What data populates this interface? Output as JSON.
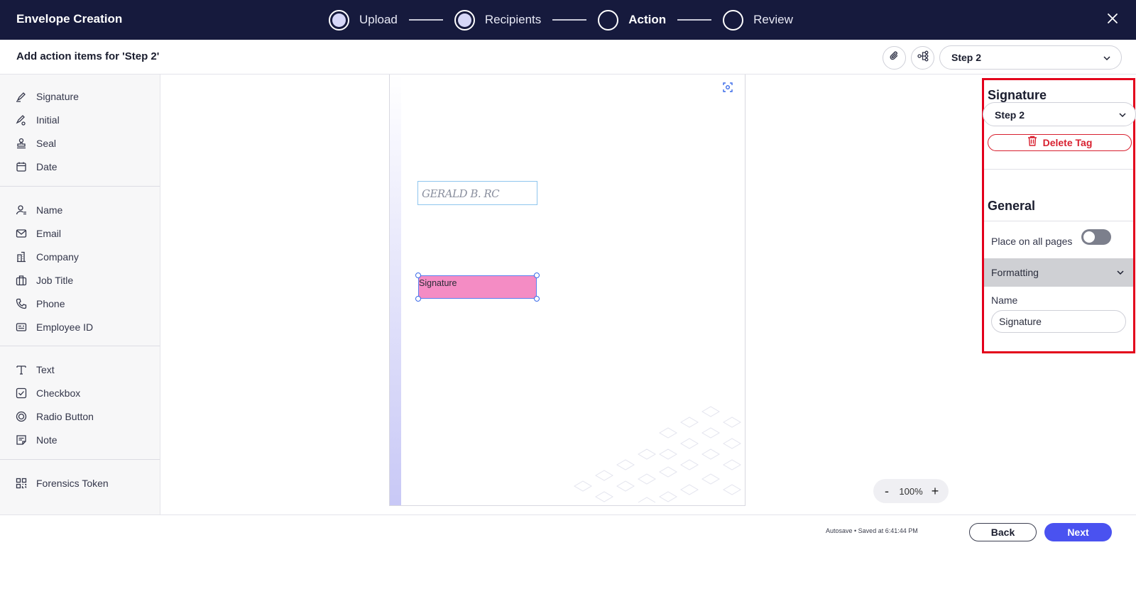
{
  "app": {
    "title": "Envelope Creation",
    "close_icon": "close-icon"
  },
  "stepper": {
    "steps": [
      {
        "label": "Upload",
        "state": "done"
      },
      {
        "label": "Recipients",
        "state": "done"
      },
      {
        "label": "Action",
        "state": "current"
      },
      {
        "label": "Review",
        "state": "todo"
      }
    ]
  },
  "subheader": {
    "title": "Add action items for 'Step 2'",
    "attach_icon": "paperclip-icon",
    "workflow_icon": "workflow-icon",
    "step_select_value": "Step 2"
  },
  "sidebar": {
    "groups": [
      [
        {
          "label": "Signature",
          "icon": "signature-pen-icon"
        },
        {
          "label": "Initial",
          "icon": "initial-pen-icon"
        },
        {
          "label": "Seal",
          "icon": "seal-stamp-icon"
        },
        {
          "label": "Date",
          "icon": "calendar-icon"
        }
      ],
      [
        {
          "label": "Name",
          "icon": "person-icon"
        },
        {
          "label": "Email",
          "icon": "envelope-icon"
        },
        {
          "label": "Company",
          "icon": "building-icon"
        },
        {
          "label": "Job Title",
          "icon": "briefcase-icon"
        },
        {
          "label": "Phone",
          "icon": "phone-icon"
        },
        {
          "label": "Employee ID",
          "icon": "id-card-icon"
        }
      ],
      [
        {
          "label": "Text",
          "icon": "text-t-icon"
        },
        {
          "label": "Checkbox",
          "icon": "checkbox-icon"
        },
        {
          "label": "Radio Button",
          "icon": "radio-button-icon"
        },
        {
          "label": "Note",
          "icon": "note-icon"
        }
      ],
      [
        {
          "label": "Forensics Token",
          "icon": "qr-token-icon"
        }
      ]
    ]
  },
  "document": {
    "signature_script": "GERALD B. RC",
    "placed_tag_label": "Signature",
    "zoom": "100%",
    "zoom_out": "-",
    "zoom_in": "+"
  },
  "panel": {
    "title": "Signature",
    "assignee_value": "Step 2",
    "delete_label": "Delete Tag",
    "general_heading": "General",
    "place_all_pages_label": "Place on all pages",
    "place_all_pages_on": false,
    "formatting_label": "Formatting",
    "name_label": "Name",
    "name_value": "Signature"
  },
  "footer": {
    "autosave": "Autosave • Saved at 6:41:44 PM",
    "back_label": "Back",
    "next_label": "Next"
  },
  "colors": {
    "topbar": "#161a3d",
    "primary": "#4a52f0",
    "danger": "#d8202f",
    "tag_fill": "#f48cc4",
    "highlight_frame": "#e3001b"
  }
}
